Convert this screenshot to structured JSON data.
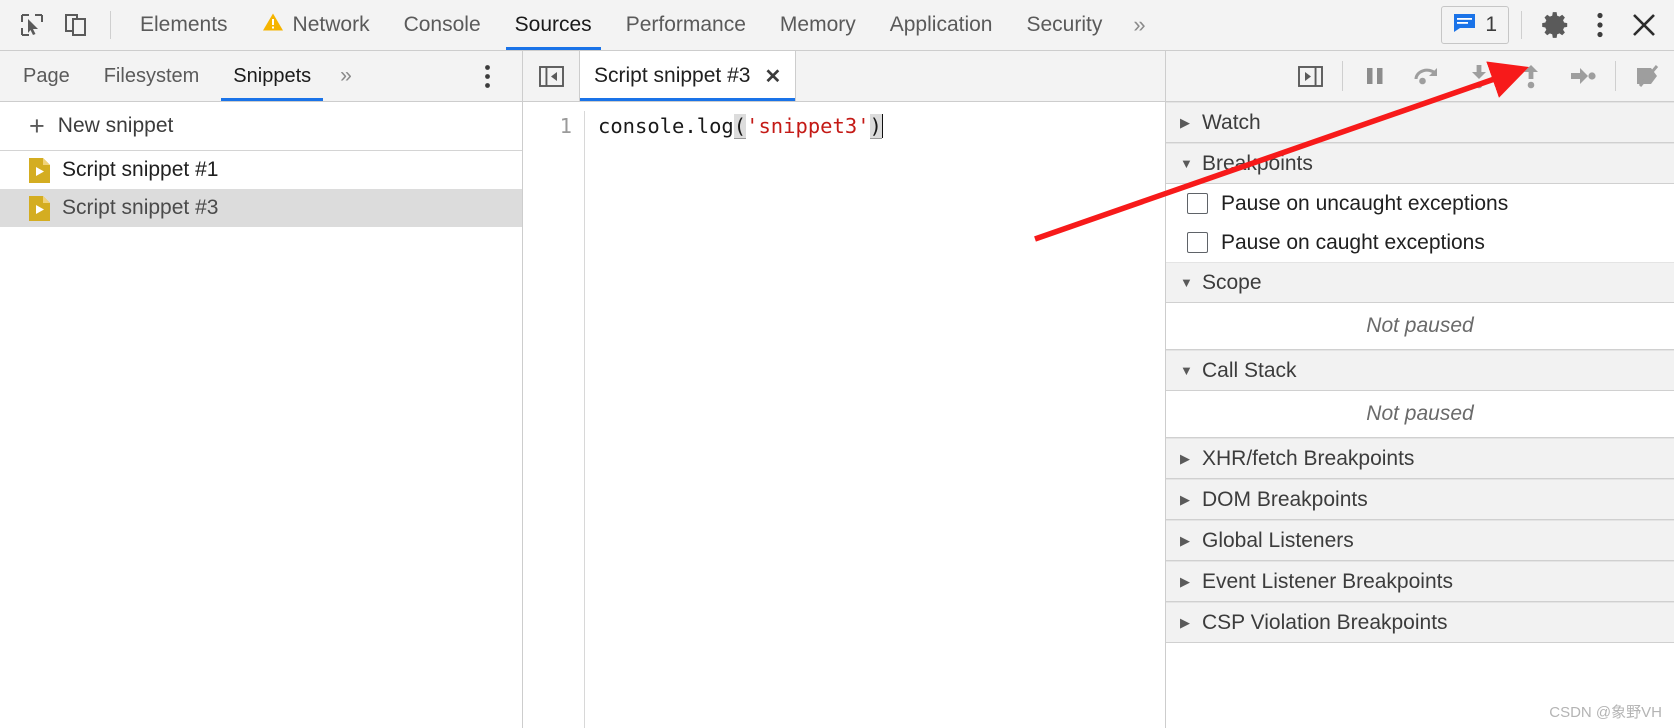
{
  "window": {
    "title": "Chrome DevTools - Sources - Snippets"
  },
  "main_toolbar": {
    "inspect_icon": "inspect-cursor-icon",
    "device_icon": "device-toolbar-icon",
    "tabs": [
      {
        "label": "Elements",
        "active": false,
        "warning": false
      },
      {
        "label": "Network",
        "active": false,
        "warning": true
      },
      {
        "label": "Console",
        "active": false,
        "warning": false
      },
      {
        "label": "Sources",
        "active": true,
        "warning": false
      },
      {
        "label": "Performance",
        "active": false,
        "warning": false
      },
      {
        "label": "Memory",
        "active": false,
        "warning": false
      },
      {
        "label": "Application",
        "active": false,
        "warning": false
      },
      {
        "label": "Security",
        "active": false,
        "warning": false
      }
    ],
    "more_tabs_icon": "chevron-double-right-icon",
    "messages": {
      "icon": "message-bubble-icon",
      "count": "1",
      "color": "#1a73e8"
    },
    "settings_icon": "gear-icon",
    "menu_icon": "kebab-menu-icon",
    "close_icon": "close-icon"
  },
  "navigator": {
    "tabs": [
      {
        "label": "Page",
        "active": false
      },
      {
        "label": "Filesystem",
        "active": false
      },
      {
        "label": "Snippets",
        "active": true
      }
    ],
    "more_tabs_icon": "chevron-double-right-icon",
    "menu_icon": "kebab-menu-icon",
    "new_snippet": {
      "label": "New snippet",
      "icon": "plus-icon"
    },
    "snippets": [
      {
        "name": "Script snippet #1",
        "icon": "snippet-file-icon",
        "selected": false
      },
      {
        "name": "Script snippet #3",
        "icon": "snippet-file-icon",
        "selected": true
      }
    ]
  },
  "editor": {
    "collapse_icon": "collapse-sidebar-left-icon",
    "tab": {
      "title": "Script snippet #3",
      "close_icon": "close-icon"
    },
    "gutter": [
      "1"
    ],
    "code": {
      "prefix": "console.log",
      "open_paren": "(",
      "string": "'snippet3'",
      "close_paren": ")"
    }
  },
  "debugger_toolbar": {
    "expand_icon": "expand-sidebar-right-icon",
    "buttons": [
      {
        "name": "pause-script-execution",
        "icon": "pause-icon"
      },
      {
        "name": "step-over-next-function-call",
        "icon": "step-over-icon"
      },
      {
        "name": "step-into-next-function-call",
        "icon": "step-into-icon"
      },
      {
        "name": "step-out-of-current-function",
        "icon": "step-out-icon"
      },
      {
        "name": "step",
        "icon": "step-icon"
      },
      {
        "name": "deactivate-breakpoints",
        "icon": "deactivate-breakpoints-icon"
      }
    ]
  },
  "debugger_panel": {
    "sections": [
      {
        "title": "Watch",
        "expanded": false
      },
      {
        "title": "Breakpoints",
        "expanded": true
      },
      {
        "title": "Scope",
        "expanded": true
      },
      {
        "title": "Call Stack",
        "expanded": true
      },
      {
        "title": "XHR/fetch Breakpoints",
        "expanded": false
      },
      {
        "title": "DOM Breakpoints",
        "expanded": false
      },
      {
        "title": "Global Listeners",
        "expanded": false
      },
      {
        "title": "Event Listener Breakpoints",
        "expanded": false
      },
      {
        "title": "CSP Violation Breakpoints",
        "expanded": false
      }
    ],
    "breakpoint_options": [
      {
        "label": "Pause on uncaught exceptions",
        "checked": false
      },
      {
        "label": "Pause on caught exceptions",
        "checked": false
      }
    ],
    "scope_status": "Not paused",
    "callstack_status": "Not paused"
  },
  "annotation": {
    "arrow_color": "#f71a1a",
    "points_to": "deactivate-breakpoints-icon"
  },
  "watermark": "CSDN @象野VH"
}
